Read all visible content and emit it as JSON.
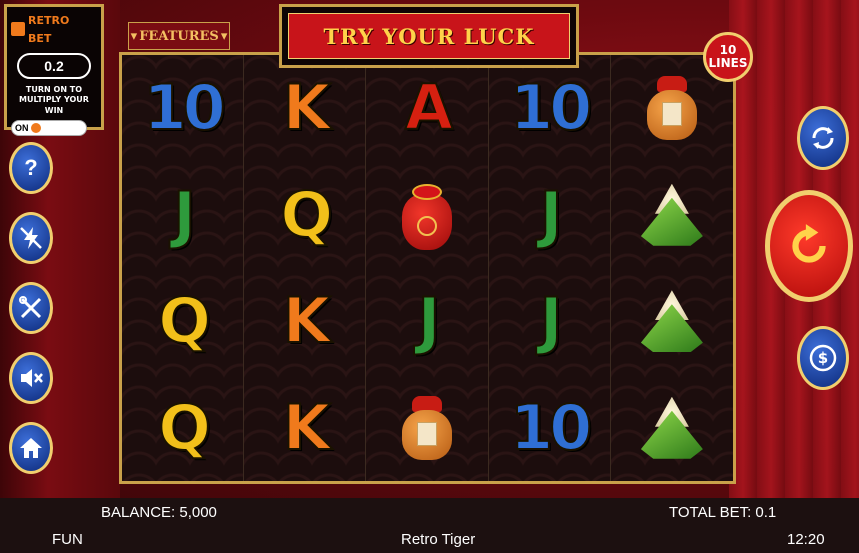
{
  "retro_bet": {
    "logo_text_1": "RETRO",
    "logo_text_2": "BET",
    "value": "0.2",
    "hint_line_1": "TURN ON TO",
    "hint_line_2": "MULTIPLY YOUR WIN",
    "toggle_label": "ON"
  },
  "features_button": {
    "label": "FEATURES"
  },
  "title_banner": {
    "text": "TRY YOUR LUCK"
  },
  "lines_badge": {
    "count": "10",
    "label": "LINES"
  },
  "reels": [
    [
      "10",
      "J",
      "Q",
      "Q"
    ],
    [
      "K",
      "Q",
      "K",
      "K"
    ],
    [
      "A",
      "red-bag",
      "J",
      "jars"
    ],
    [
      "10",
      "J",
      "J",
      "10"
    ],
    [
      "jars",
      "zongzi",
      "zongzi",
      "zongzi"
    ]
  ],
  "side_buttons": [
    "help-icon",
    "turbo-off-icon",
    "settings-tools-icon",
    "sound-mute-icon",
    "home-icon"
  ],
  "right_buttons": [
    "autoplay-icon",
    "spin-icon",
    "coin-value-icon"
  ],
  "bottom_bar": {
    "balance": "BALANCE: 5,000",
    "total_bet": "TOTAL BET: 0.1",
    "mode": "FUN",
    "game_name": "Retro Tiger",
    "clock": "12:20"
  },
  "colors": {
    "gold": "#c9a14a",
    "banner_red": "#c8141a",
    "title_yellow": "#ffd24a",
    "button_blue": "#0d2a7a"
  }
}
